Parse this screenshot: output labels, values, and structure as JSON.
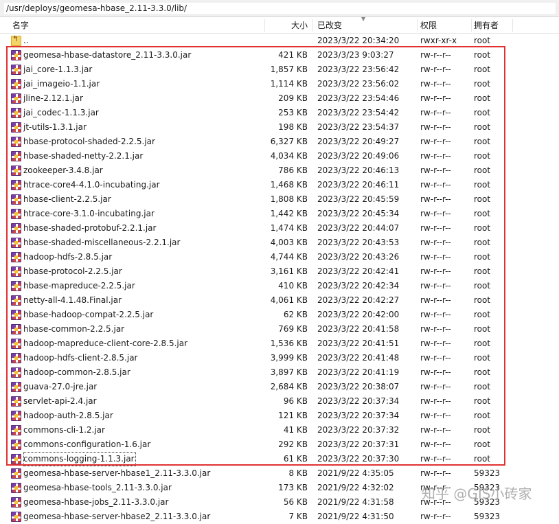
{
  "path": "/usr/deploys/geomesa-hbase_2.11-3.3.0/lib/",
  "columns": {
    "name": "名字",
    "size": "大小",
    "modified": "已改变",
    "permissions": "权限",
    "owner": "拥有者"
  },
  "parent_row": {
    "name": "..",
    "size": "",
    "modified": "2023/3/22 20:34:20",
    "permissions": "rwxr-xr-x",
    "owner": "root"
  },
  "files": [
    {
      "name": "geomesa-hbase-datastore_2.11-3.3.0.jar",
      "size": "421 KB",
      "modified": "2023/3/23 9:03:27",
      "permissions": "rw-r--r--",
      "owner": "root"
    },
    {
      "name": "jai_core-1.1.3.jar",
      "size": "1,857 KB",
      "modified": "2023/3/22 23:56:42",
      "permissions": "rw-r--r--",
      "owner": "root"
    },
    {
      "name": "jai_imageio-1.1.jar",
      "size": "1,114 KB",
      "modified": "2023/3/22 23:56:02",
      "permissions": "rw-r--r--",
      "owner": "root"
    },
    {
      "name": "jline-2.12.1.jar",
      "size": "209 KB",
      "modified": "2023/3/22 23:54:46",
      "permissions": "rw-r--r--",
      "owner": "root"
    },
    {
      "name": "jai_codec-1.1.3.jar",
      "size": "253 KB",
      "modified": "2023/3/22 23:54:42",
      "permissions": "rw-r--r--",
      "owner": "root"
    },
    {
      "name": "jt-utils-1.3.1.jar",
      "size": "198 KB",
      "modified": "2023/3/22 23:54:37",
      "permissions": "rw-r--r--",
      "owner": "root"
    },
    {
      "name": "hbase-protocol-shaded-2.2.5.jar",
      "size": "6,327 KB",
      "modified": "2023/3/22 20:49:27",
      "permissions": "rw-r--r--",
      "owner": "root"
    },
    {
      "name": "hbase-shaded-netty-2.2.1.jar",
      "size": "4,034 KB",
      "modified": "2023/3/22 20:49:06",
      "permissions": "rw-r--r--",
      "owner": "root"
    },
    {
      "name": "zookeeper-3.4.8.jar",
      "size": "786 KB",
      "modified": "2023/3/22 20:46:13",
      "permissions": "rw-r--r--",
      "owner": "root"
    },
    {
      "name": "htrace-core4-4.1.0-incubating.jar",
      "size": "1,468 KB",
      "modified": "2023/3/22 20:46:11",
      "permissions": "rw-r--r--",
      "owner": "root"
    },
    {
      "name": "hbase-client-2.2.5.jar",
      "size": "1,808 KB",
      "modified": "2023/3/22 20:45:59",
      "permissions": "rw-r--r--",
      "owner": "root"
    },
    {
      "name": "htrace-core-3.1.0-incubating.jar",
      "size": "1,442 KB",
      "modified": "2023/3/22 20:45:34",
      "permissions": "rw-r--r--",
      "owner": "root"
    },
    {
      "name": "hbase-shaded-protobuf-2.2.1.jar",
      "size": "1,474 KB",
      "modified": "2023/3/22 20:44:07",
      "permissions": "rw-r--r--",
      "owner": "root"
    },
    {
      "name": "hbase-shaded-miscellaneous-2.2.1.jar",
      "size": "4,003 KB",
      "modified": "2023/3/22 20:43:53",
      "permissions": "rw-r--r--",
      "owner": "root"
    },
    {
      "name": "hadoop-hdfs-2.8.5.jar",
      "size": "4,744 KB",
      "modified": "2023/3/22 20:43:26",
      "permissions": "rw-r--r--",
      "owner": "root"
    },
    {
      "name": "hbase-protocol-2.2.5.jar",
      "size": "3,161 KB",
      "modified": "2023/3/22 20:42:41",
      "permissions": "rw-r--r--",
      "owner": "root"
    },
    {
      "name": "hbase-mapreduce-2.2.5.jar",
      "size": "410 KB",
      "modified": "2023/3/22 20:42:34",
      "permissions": "rw-r--r--",
      "owner": "root"
    },
    {
      "name": "netty-all-4.1.48.Final.jar",
      "size": "4,061 KB",
      "modified": "2023/3/22 20:42:27",
      "permissions": "rw-r--r--",
      "owner": "root"
    },
    {
      "name": "hbase-hadoop-compat-2.2.5.jar",
      "size": "62 KB",
      "modified": "2023/3/22 20:42:00",
      "permissions": "rw-r--r--",
      "owner": "root"
    },
    {
      "name": "hbase-common-2.2.5.jar",
      "size": "769 KB",
      "modified": "2023/3/22 20:41:58",
      "permissions": "rw-r--r--",
      "owner": "root"
    },
    {
      "name": "hadoop-mapreduce-client-core-2.8.5.jar",
      "size": "1,536 KB",
      "modified": "2023/3/22 20:41:51",
      "permissions": "rw-r--r--",
      "owner": "root"
    },
    {
      "name": "hadoop-hdfs-client-2.8.5.jar",
      "size": "3,999 KB",
      "modified": "2023/3/22 20:41:48",
      "permissions": "rw-r--r--",
      "owner": "root"
    },
    {
      "name": "hadoop-common-2.8.5.jar",
      "size": "3,897 KB",
      "modified": "2023/3/22 20:41:19",
      "permissions": "rw-r--r--",
      "owner": "root"
    },
    {
      "name": "guava-27.0-jre.jar",
      "size": "2,684 KB",
      "modified": "2023/3/22 20:38:07",
      "permissions": "rw-r--r--",
      "owner": "root"
    },
    {
      "name": "servlet-api-2.4.jar",
      "size": "96 KB",
      "modified": "2023/3/22 20:37:34",
      "permissions": "rw-r--r--",
      "owner": "root"
    },
    {
      "name": "hadoop-auth-2.8.5.jar",
      "size": "121 KB",
      "modified": "2023/3/22 20:37:34",
      "permissions": "rw-r--r--",
      "owner": "root"
    },
    {
      "name": "commons-cli-1.2.jar",
      "size": "41 KB",
      "modified": "2023/3/22 20:37:32",
      "permissions": "rw-r--r--",
      "owner": "root"
    },
    {
      "name": "commons-configuration-1.6.jar",
      "size": "292 KB",
      "modified": "2023/3/22 20:37:31",
      "permissions": "rw-r--r--",
      "owner": "root"
    },
    {
      "name": "commons-logging-1.1.3.jar",
      "size": "61 KB",
      "modified": "2023/3/22 20:37:30",
      "permissions": "rw-r--r--",
      "owner": "root",
      "focused": true
    },
    {
      "name": "geomesa-hbase-server-hbase1_2.11-3.3.0.jar",
      "size": "8 KB",
      "modified": "2021/9/22 4:35:05",
      "permissions": "rw-r--r--",
      "owner": "59323"
    },
    {
      "name": "geomesa-hbase-tools_2.11-3.3.0.jar",
      "size": "173 KB",
      "modified": "2021/9/22 4:32:02",
      "permissions": "rw-r--r--",
      "owner": "59323"
    },
    {
      "name": "geomesa-hbase-jobs_2.11-3.3.0.jar",
      "size": "56 KB",
      "modified": "2021/9/22 4:31:58",
      "permissions": "rw-r--r--",
      "owner": "59323"
    },
    {
      "name": "geomesa-hbase-server-hbase2_2.11-3.3.0.jar",
      "size": "7 KB",
      "modified": "2021/9/22 4:31:50",
      "permissions": "rw-r--r--",
      "owner": "59323"
    }
  ],
  "highlight_color": "#e0302f",
  "watermark": "知乎 @GIS小砖家"
}
